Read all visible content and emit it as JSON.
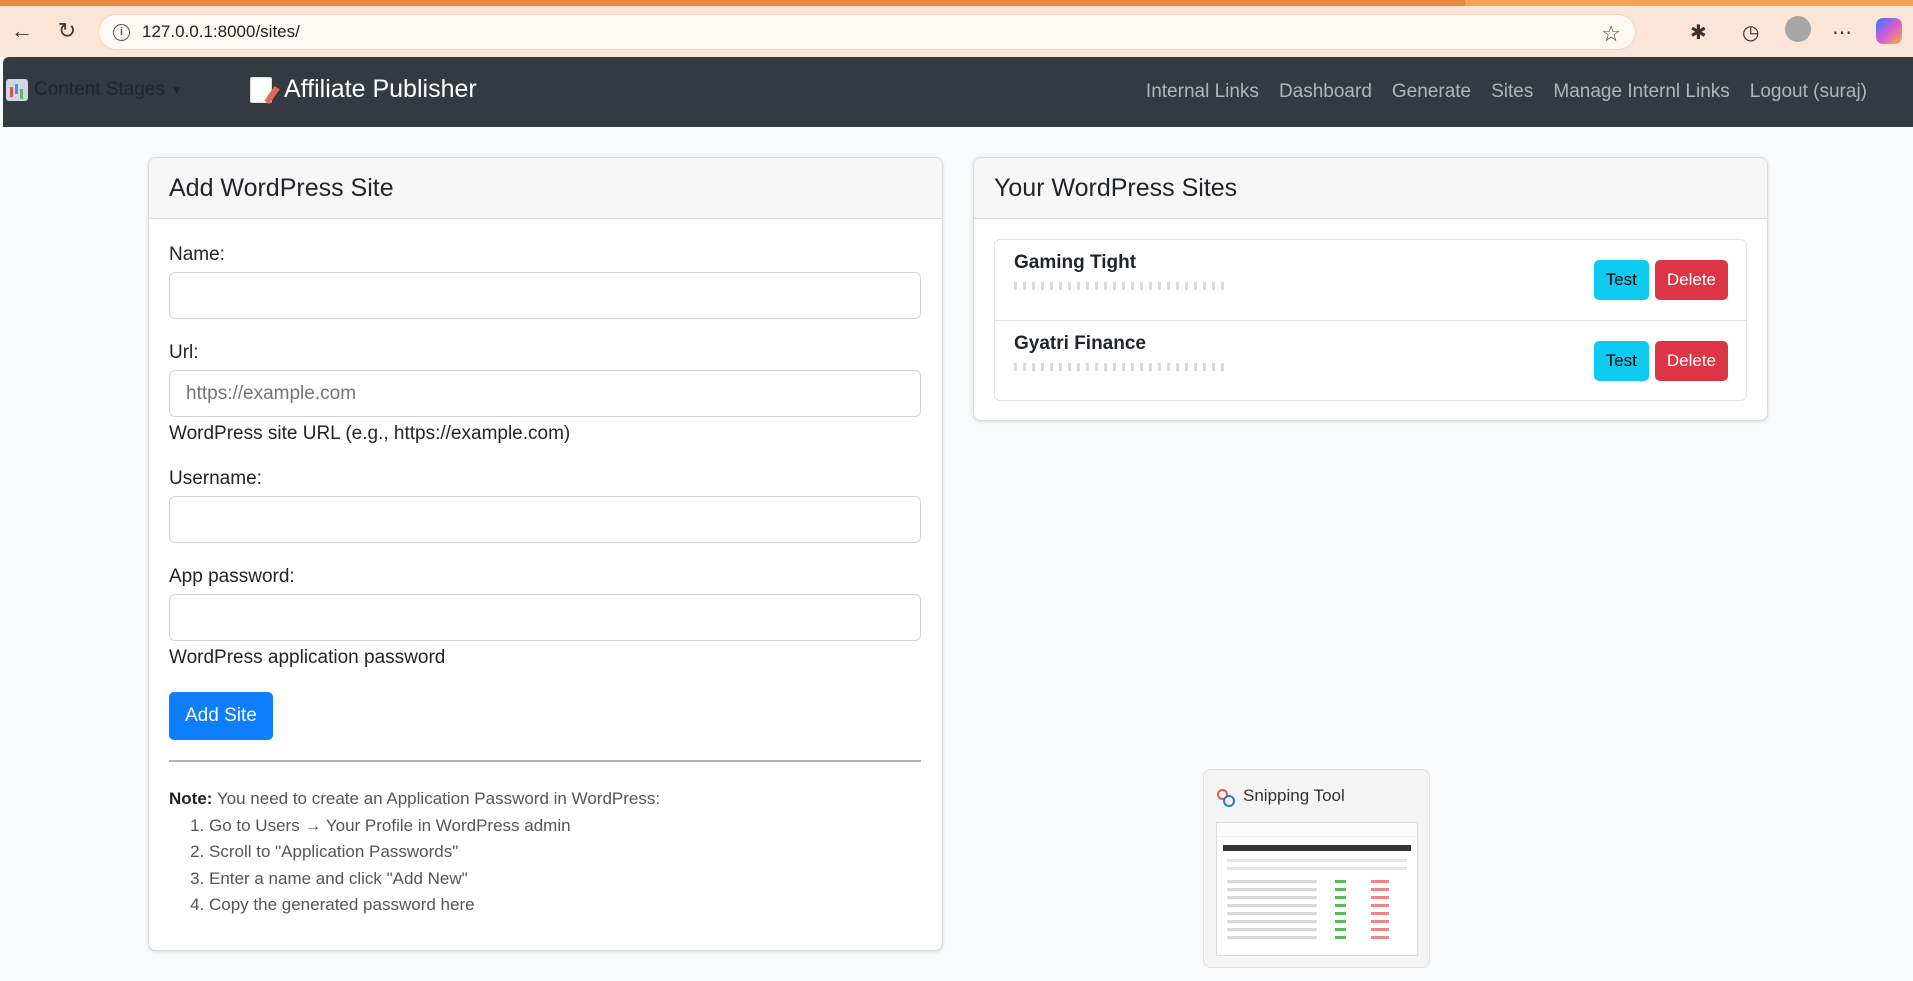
{
  "browser": {
    "url": "127.0.0.1:8000/sites/"
  },
  "navbar": {
    "stages_label": "Content Stages",
    "brand": "Affiliate Publisher",
    "links": [
      "Internal Links",
      "Dashboard",
      "Generate",
      "Sites",
      "Manage Internl Links",
      "Logout (suraj)"
    ]
  },
  "add_site": {
    "title": "Add WordPress Site",
    "name_label": "Name:",
    "name_value": "",
    "url_label": "Url:",
    "url_placeholder": "https://example.com",
    "url_help": "WordPress site URL (e.g., https://example.com)",
    "username_label": "Username:",
    "username_value": "",
    "password_label": "App password:",
    "password_help": "WordPress application password",
    "submit_label": "Add Site",
    "note_title": "Note:",
    "note_text": " You need to create an Application Password in WordPress:",
    "steps": [
      "Go to Users → Your Profile in WordPress admin",
      "Scroll to \"Application Passwords\"",
      "Enter a name and click \"Add New\"",
      "Copy the generated password here"
    ]
  },
  "sites": {
    "title": "Your WordPress Sites",
    "items": [
      {
        "name": "Gaming Tight",
        "test_label": "Test",
        "delete_label": "Delete"
      },
      {
        "name": "Gyatri Finance",
        "test_label": "Test",
        "delete_label": "Delete"
      }
    ]
  },
  "snipping_tool": {
    "title": "Snipping Tool"
  },
  "colors": {
    "navbar_bg": "#343a40",
    "primary": "#0d7efd",
    "info": "#0dcaf0",
    "danger": "#dc3545",
    "browser_bar": "#fbe5d6"
  },
  "icons": [
    "back-icon",
    "reload-icon",
    "info-icon",
    "star-icon",
    "extensions-icon",
    "history-icon",
    "profile-icon",
    "more-icon",
    "copilot-icon",
    "chart-icon",
    "memo-icon",
    "caret-down-icon",
    "snipping-tool-icon"
  ]
}
